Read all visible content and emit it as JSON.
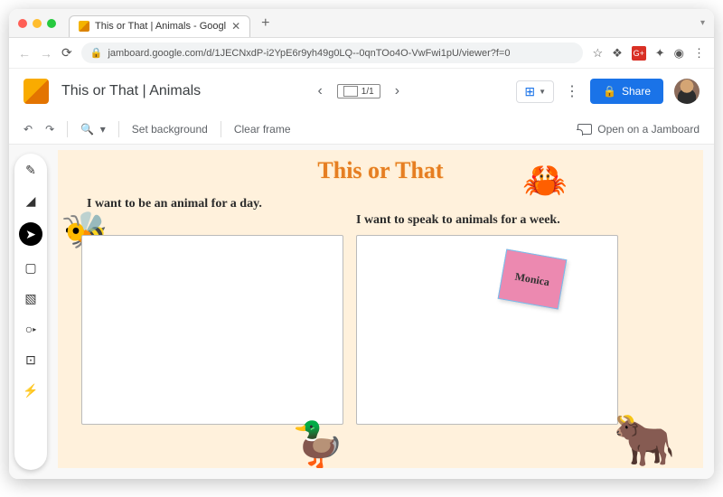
{
  "browser": {
    "tab_title": "This or That | Animals - Googl",
    "url": "jamboard.google.com/d/1JECNxdP-i2YpE6r9yh49g0LQ--0qnTOo4O-VwFwi1pU/viewer?f=0"
  },
  "app": {
    "doc_title": "This or That | Animals",
    "frame_indicator": "1/1",
    "share_label": "Share",
    "set_background": "Set background",
    "clear_frame": "Clear frame",
    "open_jamboard": "Open on a Jamboard"
  },
  "board": {
    "title": "This or That",
    "left_prompt": "I want to be an animal for a day.",
    "right_prompt": "I want to speak to animals for a week.",
    "sticky_note": "Monica",
    "graphics": {
      "bee": "🐝",
      "crab": "🦀",
      "goose": "🦆",
      "yak": "🐂"
    }
  },
  "tools": [
    "pen",
    "eraser",
    "select",
    "sticky-note",
    "image",
    "circle",
    "textbox",
    "laser"
  ]
}
